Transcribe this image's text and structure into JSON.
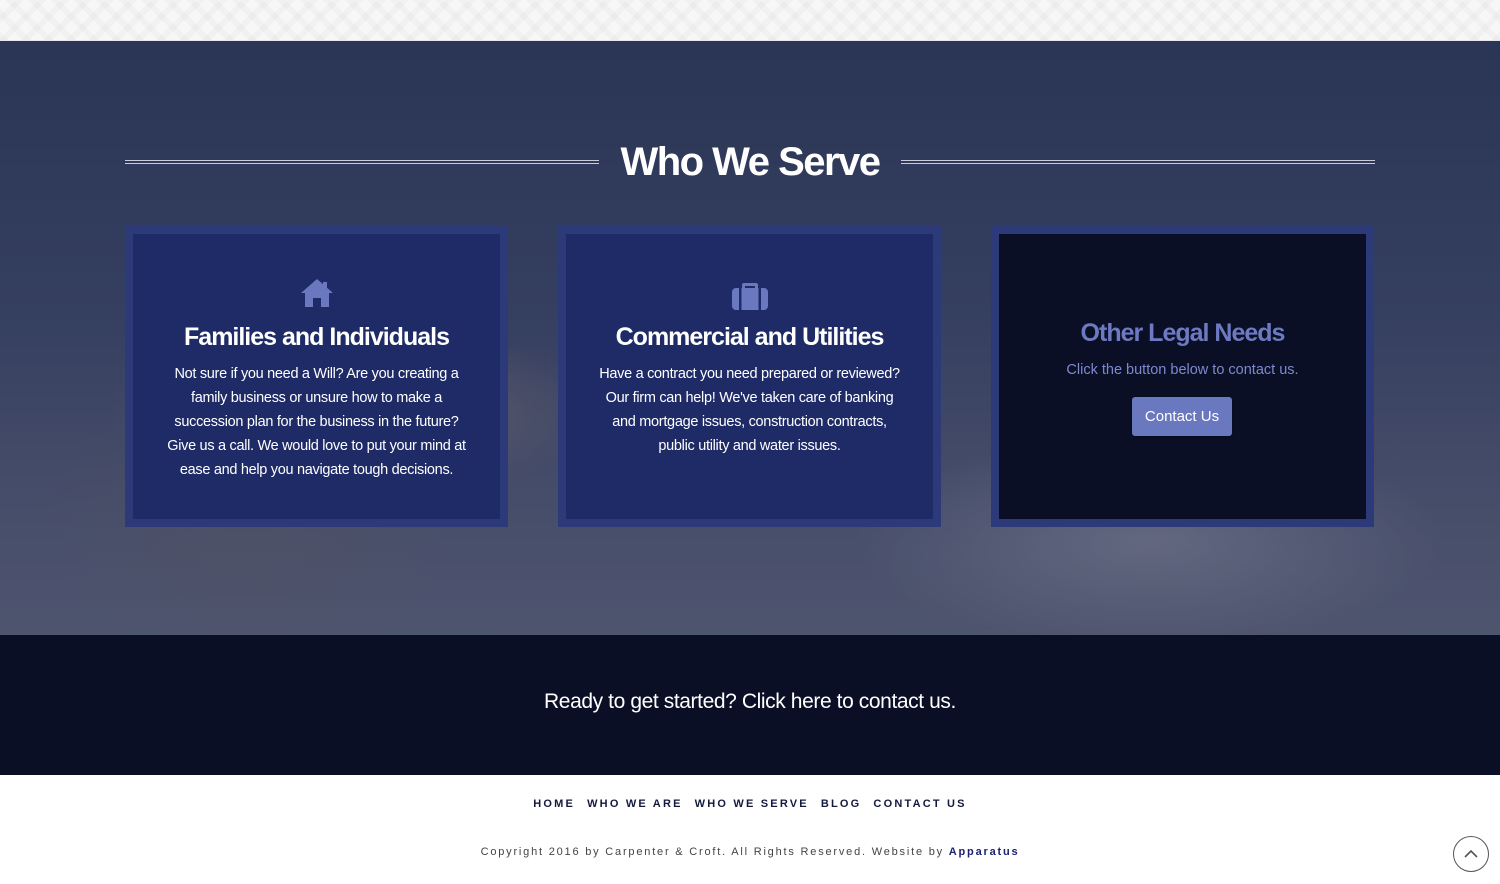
{
  "colors": {
    "card_blue": "#1e2b66",
    "card_border": "#2c3a7a",
    "card_dark": "#0a0f25",
    "accent": "#6a78c0",
    "cta_band": "#0b0f26",
    "icon": "#6a78c0"
  },
  "section": {
    "title": "Who We Serve"
  },
  "cards": [
    {
      "icon": "home-icon",
      "title": "Families and Individuals",
      "text": "Not sure if you need a Will? Are you creating a family business or unsure how to make a succession plan for the business in the future? Give us a call. We would love to put your mind at ease and help you navigate tough decisions."
    },
    {
      "icon": "briefcase-icon",
      "title": "Commercial and Utilities",
      "text": "Have a contract you need prepared or reviewed? Our firm can help! We've taken care of banking and mortgage issues, construction contracts, public utility and water issues."
    },
    {
      "title": "Other Legal Needs",
      "subtitle": "Click the button below to contact us.",
      "button_label": "Contact Us"
    }
  ],
  "cta": {
    "text": "Ready to get started? Click here to contact us."
  },
  "footer": {
    "nav": [
      "HOME",
      "WHO WE ARE",
      "WHO WE SERVE",
      "BLOG",
      "CONTACT US"
    ],
    "copyright": "Copyright 2016 by Carpenter & Croft. All Rights Reserved. Website by",
    "credit_link": "Apparatus"
  },
  "back_to_top_icon": "chevron-up-circle-icon"
}
